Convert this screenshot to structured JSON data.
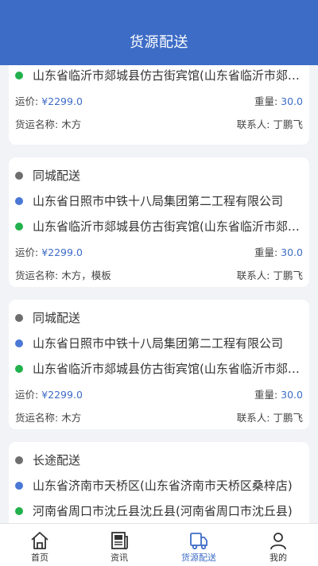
{
  "header": {
    "title": "货源配送"
  },
  "cards": [
    {
      "type": null,
      "origin": null,
      "destination": "山东省临沂市郯城县仿古街宾馆(山东省临沂市郯城县仿古街宾馆)",
      "freight_label": "运价:",
      "freight": "¥2299.0",
      "weight_label": "重量:",
      "weight": "30.0",
      "goods_label": "货运名称:",
      "goods": "木方",
      "contact_label": "联系人:",
      "contact": "丁鹏飞"
    },
    {
      "type": "同城配送",
      "origin": "山东省日照市中铁十八局集团第二工程有限公司",
      "destination": "山东省临沂市郯城县仿古街宾馆(山东省临沂市郯城县仿古街宾馆)",
      "freight_label": "运价:",
      "freight": "¥2299.0",
      "weight_label": "重量:",
      "weight": "30.0",
      "goods_label": "货运名称:",
      "goods": "木方，模板",
      "contact_label": "联系人:",
      "contact": "丁鹏飞"
    },
    {
      "type": "同城配送",
      "origin": "山东省日照市中铁十八局集团第二工程有限公司",
      "destination": "山东省临沂市郯城县仿古街宾馆(山东省临沂市郯城县仿古街宾馆)",
      "freight_label": "运价:",
      "freight": "¥2299.0",
      "weight_label": "重量:",
      "weight": "30.0",
      "goods_label": "货运名称:",
      "goods": "木方",
      "contact_label": "联系人:",
      "contact": "丁鹏飞"
    },
    {
      "type": "长途配送",
      "origin": "山东省济南市天桥区(山东省济南市天桥区桑梓店)",
      "destination": "河南省周口市沈丘县沈丘县(河南省周口市沈丘县)"
    }
  ],
  "tabbar": {
    "items": [
      {
        "label": "首页",
        "icon": "home-icon"
      },
      {
        "label": "资讯",
        "icon": "news-icon"
      },
      {
        "label": "货源配送",
        "icon": "truck-icon",
        "active": true
      },
      {
        "label": "我的",
        "icon": "user-icon"
      }
    ]
  },
  "colors": {
    "accent": "#3d6cc6",
    "origin_dot": "#4a78d6",
    "destination_dot": "#22b14c",
    "type_dot": "#6e6e6e"
  }
}
